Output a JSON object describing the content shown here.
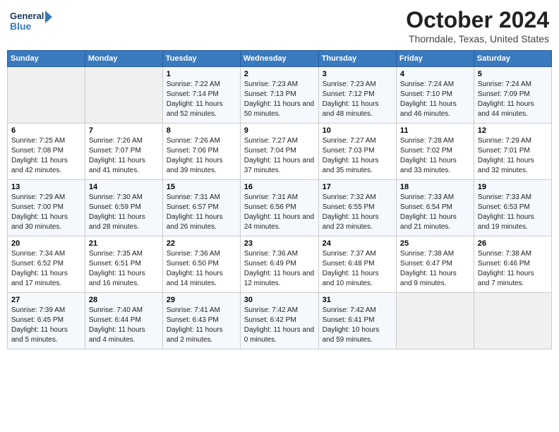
{
  "header": {
    "logo_general": "General",
    "logo_blue": "Blue",
    "month_title": "October 2024",
    "location": "Thorndale, Texas, United States"
  },
  "days_of_week": [
    "Sunday",
    "Monday",
    "Tuesday",
    "Wednesday",
    "Thursday",
    "Friday",
    "Saturday"
  ],
  "weeks": [
    [
      {
        "day": "",
        "sunrise": "",
        "sunset": "",
        "daylight": ""
      },
      {
        "day": "",
        "sunrise": "",
        "sunset": "",
        "daylight": ""
      },
      {
        "day": "1",
        "sunrise": "Sunrise: 7:22 AM",
        "sunset": "Sunset: 7:14 PM",
        "daylight": "Daylight: 11 hours and 52 minutes."
      },
      {
        "day": "2",
        "sunrise": "Sunrise: 7:23 AM",
        "sunset": "Sunset: 7:13 PM",
        "daylight": "Daylight: 11 hours and 50 minutes."
      },
      {
        "day": "3",
        "sunrise": "Sunrise: 7:23 AM",
        "sunset": "Sunset: 7:12 PM",
        "daylight": "Daylight: 11 hours and 48 minutes."
      },
      {
        "day": "4",
        "sunrise": "Sunrise: 7:24 AM",
        "sunset": "Sunset: 7:10 PM",
        "daylight": "Daylight: 11 hours and 46 minutes."
      },
      {
        "day": "5",
        "sunrise": "Sunrise: 7:24 AM",
        "sunset": "Sunset: 7:09 PM",
        "daylight": "Daylight: 11 hours and 44 minutes."
      }
    ],
    [
      {
        "day": "6",
        "sunrise": "Sunrise: 7:25 AM",
        "sunset": "Sunset: 7:08 PM",
        "daylight": "Daylight: 11 hours and 42 minutes."
      },
      {
        "day": "7",
        "sunrise": "Sunrise: 7:26 AM",
        "sunset": "Sunset: 7:07 PM",
        "daylight": "Daylight: 11 hours and 41 minutes."
      },
      {
        "day": "8",
        "sunrise": "Sunrise: 7:26 AM",
        "sunset": "Sunset: 7:06 PM",
        "daylight": "Daylight: 11 hours and 39 minutes."
      },
      {
        "day": "9",
        "sunrise": "Sunrise: 7:27 AM",
        "sunset": "Sunset: 7:04 PM",
        "daylight": "Daylight: 11 hours and 37 minutes."
      },
      {
        "day": "10",
        "sunrise": "Sunrise: 7:27 AM",
        "sunset": "Sunset: 7:03 PM",
        "daylight": "Daylight: 11 hours and 35 minutes."
      },
      {
        "day": "11",
        "sunrise": "Sunrise: 7:28 AM",
        "sunset": "Sunset: 7:02 PM",
        "daylight": "Daylight: 11 hours and 33 minutes."
      },
      {
        "day": "12",
        "sunrise": "Sunrise: 7:29 AM",
        "sunset": "Sunset: 7:01 PM",
        "daylight": "Daylight: 11 hours and 32 minutes."
      }
    ],
    [
      {
        "day": "13",
        "sunrise": "Sunrise: 7:29 AM",
        "sunset": "Sunset: 7:00 PM",
        "daylight": "Daylight: 11 hours and 30 minutes."
      },
      {
        "day": "14",
        "sunrise": "Sunrise: 7:30 AM",
        "sunset": "Sunset: 6:59 PM",
        "daylight": "Daylight: 11 hours and 28 minutes."
      },
      {
        "day": "15",
        "sunrise": "Sunrise: 7:31 AM",
        "sunset": "Sunset: 6:57 PM",
        "daylight": "Daylight: 11 hours and 26 minutes."
      },
      {
        "day": "16",
        "sunrise": "Sunrise: 7:31 AM",
        "sunset": "Sunset: 6:56 PM",
        "daylight": "Daylight: 11 hours and 24 minutes."
      },
      {
        "day": "17",
        "sunrise": "Sunrise: 7:32 AM",
        "sunset": "Sunset: 6:55 PM",
        "daylight": "Daylight: 11 hours and 23 minutes."
      },
      {
        "day": "18",
        "sunrise": "Sunrise: 7:33 AM",
        "sunset": "Sunset: 6:54 PM",
        "daylight": "Daylight: 11 hours and 21 minutes."
      },
      {
        "day": "19",
        "sunrise": "Sunrise: 7:33 AM",
        "sunset": "Sunset: 6:53 PM",
        "daylight": "Daylight: 11 hours and 19 minutes."
      }
    ],
    [
      {
        "day": "20",
        "sunrise": "Sunrise: 7:34 AM",
        "sunset": "Sunset: 6:52 PM",
        "daylight": "Daylight: 11 hours and 17 minutes."
      },
      {
        "day": "21",
        "sunrise": "Sunrise: 7:35 AM",
        "sunset": "Sunset: 6:51 PM",
        "daylight": "Daylight: 11 hours and 16 minutes."
      },
      {
        "day": "22",
        "sunrise": "Sunrise: 7:36 AM",
        "sunset": "Sunset: 6:50 PM",
        "daylight": "Daylight: 11 hours and 14 minutes."
      },
      {
        "day": "23",
        "sunrise": "Sunrise: 7:36 AM",
        "sunset": "Sunset: 6:49 PM",
        "daylight": "Daylight: 11 hours and 12 minutes."
      },
      {
        "day": "24",
        "sunrise": "Sunrise: 7:37 AM",
        "sunset": "Sunset: 6:48 PM",
        "daylight": "Daylight: 11 hours and 10 minutes."
      },
      {
        "day": "25",
        "sunrise": "Sunrise: 7:38 AM",
        "sunset": "Sunset: 6:47 PM",
        "daylight": "Daylight: 11 hours and 9 minutes."
      },
      {
        "day": "26",
        "sunrise": "Sunrise: 7:38 AM",
        "sunset": "Sunset: 6:46 PM",
        "daylight": "Daylight: 11 hours and 7 minutes."
      }
    ],
    [
      {
        "day": "27",
        "sunrise": "Sunrise: 7:39 AM",
        "sunset": "Sunset: 6:45 PM",
        "daylight": "Daylight: 11 hours and 5 minutes."
      },
      {
        "day": "28",
        "sunrise": "Sunrise: 7:40 AM",
        "sunset": "Sunset: 6:44 PM",
        "daylight": "Daylight: 11 hours and 4 minutes."
      },
      {
        "day": "29",
        "sunrise": "Sunrise: 7:41 AM",
        "sunset": "Sunset: 6:43 PM",
        "daylight": "Daylight: 11 hours and 2 minutes."
      },
      {
        "day": "30",
        "sunrise": "Sunrise: 7:42 AM",
        "sunset": "Sunset: 6:42 PM",
        "daylight": "Daylight: 11 hours and 0 minutes."
      },
      {
        "day": "31",
        "sunrise": "Sunrise: 7:42 AM",
        "sunset": "Sunset: 6:41 PM",
        "daylight": "Daylight: 10 hours and 59 minutes."
      },
      {
        "day": "",
        "sunrise": "",
        "sunset": "",
        "daylight": ""
      },
      {
        "day": "",
        "sunrise": "",
        "sunset": "",
        "daylight": ""
      }
    ]
  ]
}
